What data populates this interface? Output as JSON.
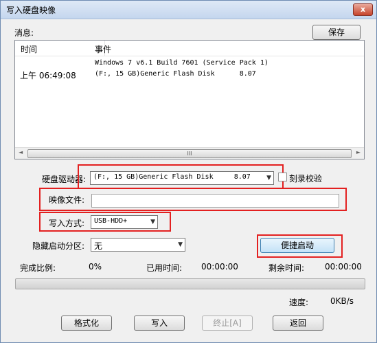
{
  "window": {
    "title": "写入硬盘映像",
    "close": "x"
  },
  "messages": {
    "label": "消息:",
    "save": "保存",
    "columns": [
      "时间",
      "事件"
    ],
    "rows": [
      {
        "time": "",
        "event": "Windows 7 v6.1 Build 7601 (Service Pack 1)"
      },
      {
        "time": "上午 06:49:08",
        "event": "(F:, 15 GB)Generic Flash Disk      8.07"
      }
    ],
    "scroll_left": "◄",
    "scroll_right": "►",
    "scroll_grip": "III"
  },
  "drive": {
    "label": "硬盘驱动器:",
    "value": "(F:, 15 GB)Generic Flash Disk     8.07"
  },
  "verify": {
    "label": "刻录校验",
    "checked": false
  },
  "image_file": {
    "label": "映像文件:",
    "value": ""
  },
  "write_mode": {
    "label": "写入方式:",
    "value": "USB-HDD+"
  },
  "hidden_partition": {
    "label": "隐藏启动分区:",
    "value": "无"
  },
  "quick_boot": "便捷启动",
  "stats": {
    "progress_label": "完成比例:",
    "progress_value": "0%",
    "elapsed_label": "已用时间:",
    "elapsed_value": "00:00:00",
    "remaining_label": "剩余时间:",
    "remaining_value": "00:00:00",
    "speed_label": "速度:",
    "speed_value": "0KB/s"
  },
  "progress": {
    "fraction": 0
  },
  "buttons": {
    "format": "格式化",
    "write": "写入",
    "abort": "终止[A]",
    "back": "返回"
  },
  "dropdown_arrow": "▼",
  "colors": {
    "highlight": "#e32020",
    "progress_fill": "#4fb04f"
  }
}
